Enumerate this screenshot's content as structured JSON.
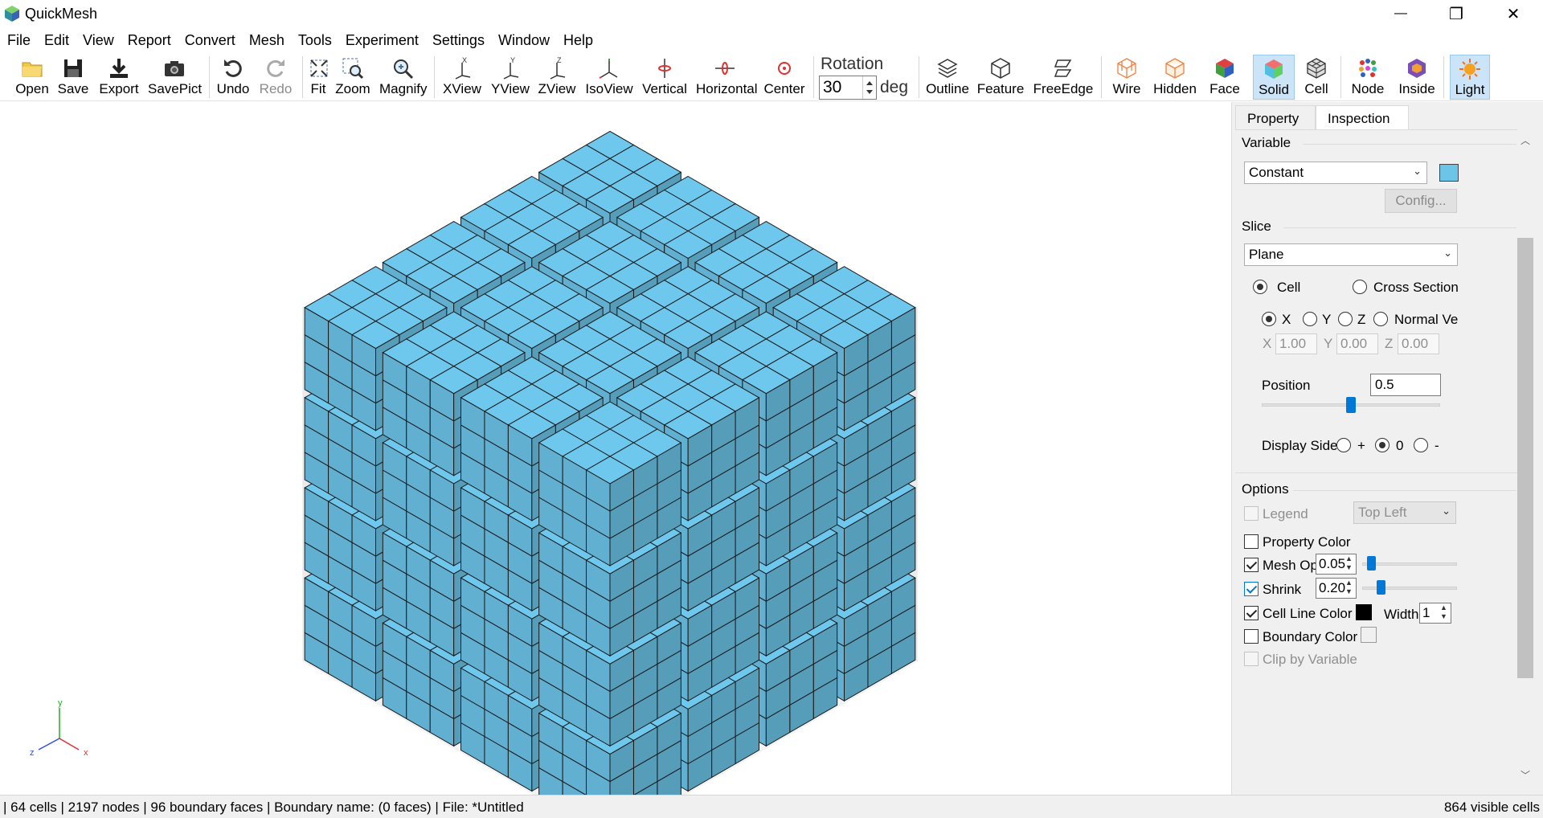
{
  "window": {
    "title": "QuickMesh",
    "minimize_glyph": "—",
    "maximize_glyph": "❐",
    "close_glyph": "✕"
  },
  "menu": [
    "File",
    "Edit",
    "View",
    "Report",
    "Convert",
    "Mesh",
    "Tools",
    "Experiment",
    "Settings",
    "Window",
    "Help"
  ],
  "toolbar": {
    "open": "Open",
    "save": "Save",
    "export": "Export",
    "savepict": "SavePict",
    "undo": "Undo",
    "redo": "Redo",
    "fit": "Fit",
    "zoom": "Zoom",
    "magnify": "Magnify",
    "xview": "XView",
    "yview": "YView",
    "zview": "ZView",
    "isoview": "IsoView",
    "vertical": "Vertical",
    "horizontal": "Horizontal",
    "center": "Center",
    "rotation_label": "Rotation",
    "rotation_value": "30",
    "rotation_unit": "deg",
    "outline": "Outline",
    "feature": "Feature",
    "freeedge": "FreeEdge",
    "wire": "Wire",
    "hidden": "Hidden",
    "face": "Face",
    "solid": "Solid",
    "cell": "Cell",
    "node": "Node",
    "inside": "Inside",
    "light": "Light",
    "more": "»"
  },
  "viewport": {
    "axis_x": "x",
    "axis_y": "y",
    "axis_z": "z",
    "mesh_color": "#6cc4e8",
    "box_color": "#ebebeb",
    "axis_colors": {
      "x": "#e03030",
      "y": "#20b020",
      "z": "#3050e0"
    }
  },
  "panel": {
    "tabs": {
      "property": "Property",
      "inspection": "Inspection"
    },
    "variable": {
      "title": "Variable",
      "value": "Constant",
      "color": "#6cc4e8",
      "config": "Config..."
    },
    "slice": {
      "title": "Slice",
      "value": "Plane",
      "mode_cell": "Cell",
      "mode_cross": "Cross Section",
      "axis_x": "X",
      "axis_y": "Y",
      "axis_z": "Z",
      "axis_normal": "Normal Ve",
      "x_label": "X",
      "x_value": "1.00",
      "y_label": "Y",
      "y_value": "0.00",
      "z_label": "Z",
      "z_value": "0.00",
      "position_label": "Position",
      "position_value": "0.5",
      "position_slider": 0.5,
      "display_side_label": "Display Side",
      "side_plus": "+",
      "side_zero": "0",
      "side_minus": "-"
    },
    "options": {
      "title": "Options",
      "legend": "Legend",
      "legend_pos": "Top Left",
      "property_color": "Property Color",
      "mesh_opacity": "Mesh Opa",
      "mesh_opacity_value": "0.05",
      "mesh_opacity_slider": 0.05,
      "shrink": "Shrink",
      "shrink_value": "0.20",
      "shrink_slider": 0.2,
      "cell_line_color": "Cell Line Color",
      "cell_line_swatch": "#000000",
      "width_label": "Width",
      "width_value": "1",
      "boundary_color": "Boundary Color",
      "boundary_swatch": "#f0f0f0",
      "clip_by_variable": "Clip by Variable"
    }
  },
  "status": {
    "left": "| 64 cells | 2197 nodes | 96 boundary faces |  Boundary name:  (0 faces) | File: *Untitled",
    "right": "864 visible cells"
  }
}
